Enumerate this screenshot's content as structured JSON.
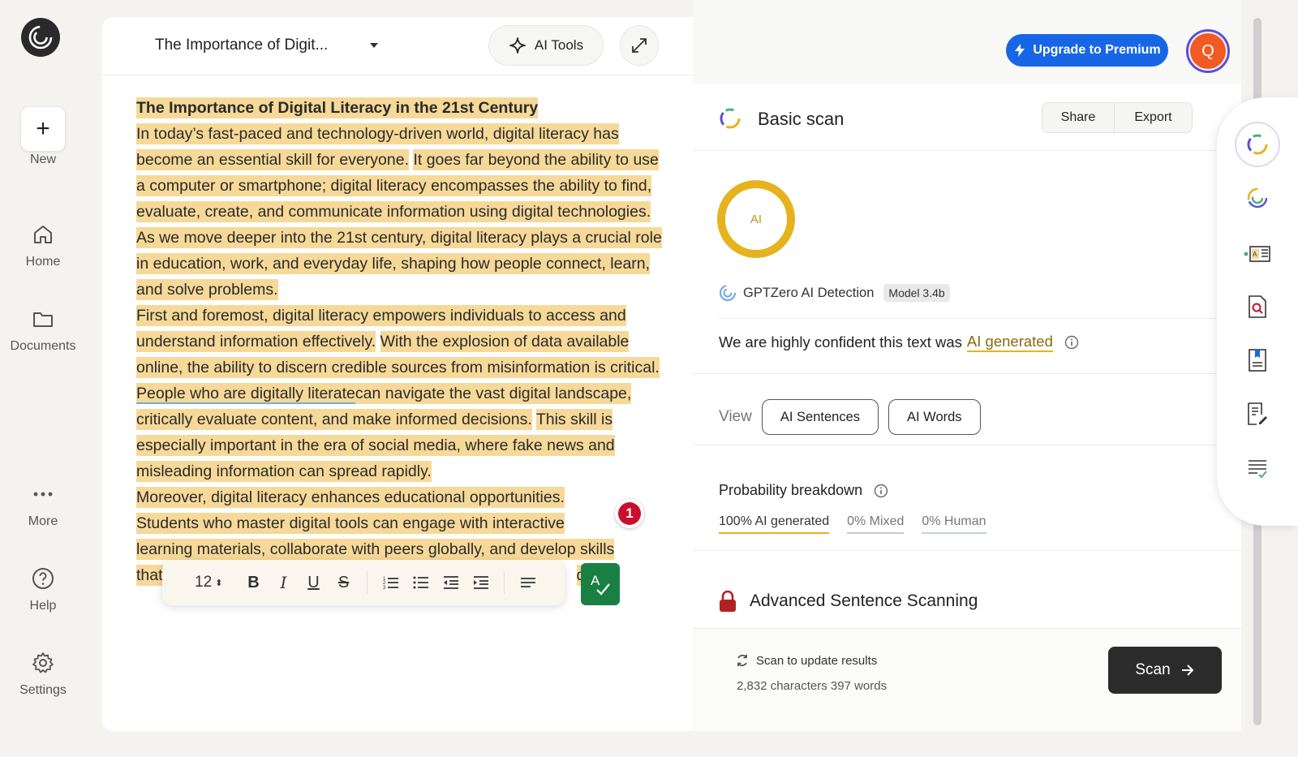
{
  "nav": {
    "new_label": "New",
    "items": [
      {
        "label": "Home",
        "icon": "home-icon"
      },
      {
        "label": "Documents",
        "icon": "folder-icon"
      },
      {
        "label": "More",
        "icon": "more-icon"
      },
      {
        "label": "Help",
        "icon": "help-icon"
      },
      {
        "label": "Settings",
        "icon": "gear-icon"
      }
    ]
  },
  "editor": {
    "doc_title": "The Importance of Digit...",
    "ai_tools_label": "AI Tools",
    "title_line": "The Importance of Digital Literacy in the 21st Century",
    "para1": [
      "In today’s fast-paced and technology-driven world, digital literacy has become an essential skill for everyone.",
      "It goes far beyond the ability to use a computer or smartphone; digital literacy encompasses the ability to find, evaluate, create, and communicate information using digital technologies.",
      "As we move deeper into the 21st century, digital literacy plays a crucial role in education, work, and everyday life, shaping how people connect, learn, and solve problems."
    ],
    "para2": [
      "First and foremost, digital literacy empowers individuals to access and understand information effectively.",
      "With the explosion of data available online, the ability to discern credible sources from misinformation is critical.",
      "People who are digitally literate",
      "can navigate the vast digital landscape, critically evaluate content, and make informed decisions.",
      "This skill is especially important in the era of social media, where fake news and misleading information can spread rapidly."
    ],
    "para3": [
      "Moreover, digital literacy enhances educational opportunities.",
      "Students who master digital tools can engage with interactive",
      "learning materials, collaborate with peers globally, and develop skills",
      "that",
      "d"
    ],
    "badge_count": "1",
    "font_size": "12"
  },
  "header": {
    "upgrade_label": "Upgrade to Premium",
    "avatar_initial": "Q"
  },
  "scan": {
    "title": "Basic scan",
    "share_label": "Share",
    "export_label": "Export",
    "ring_label": "AI",
    "detector_name": "GPTZero AI Detection",
    "model_tag": "Model 3.4b",
    "confidence_prefix": "We are highly confident this text was",
    "confidence_result": "AI generated",
    "view_label": "View",
    "view_options": [
      "AI Sentences",
      "AI Words"
    ],
    "prob_title": "Probability breakdown",
    "prob_ai": "100% AI generated",
    "prob_mixed": "0% Mixed",
    "prob_human": "0% Human",
    "advanced_title": "Advanced Sentence Scanning",
    "update_note": "Scan to update results",
    "counts": "2,832 characters 397 words",
    "scan_label": "Scan"
  },
  "colors": {
    "highlight": "#f6d998",
    "ai_ring": "#e6b21e",
    "upgrade": "#1766e6",
    "grammar": "#1a7f43",
    "badge": "#c8102e",
    "avatar": "#f15a22"
  }
}
